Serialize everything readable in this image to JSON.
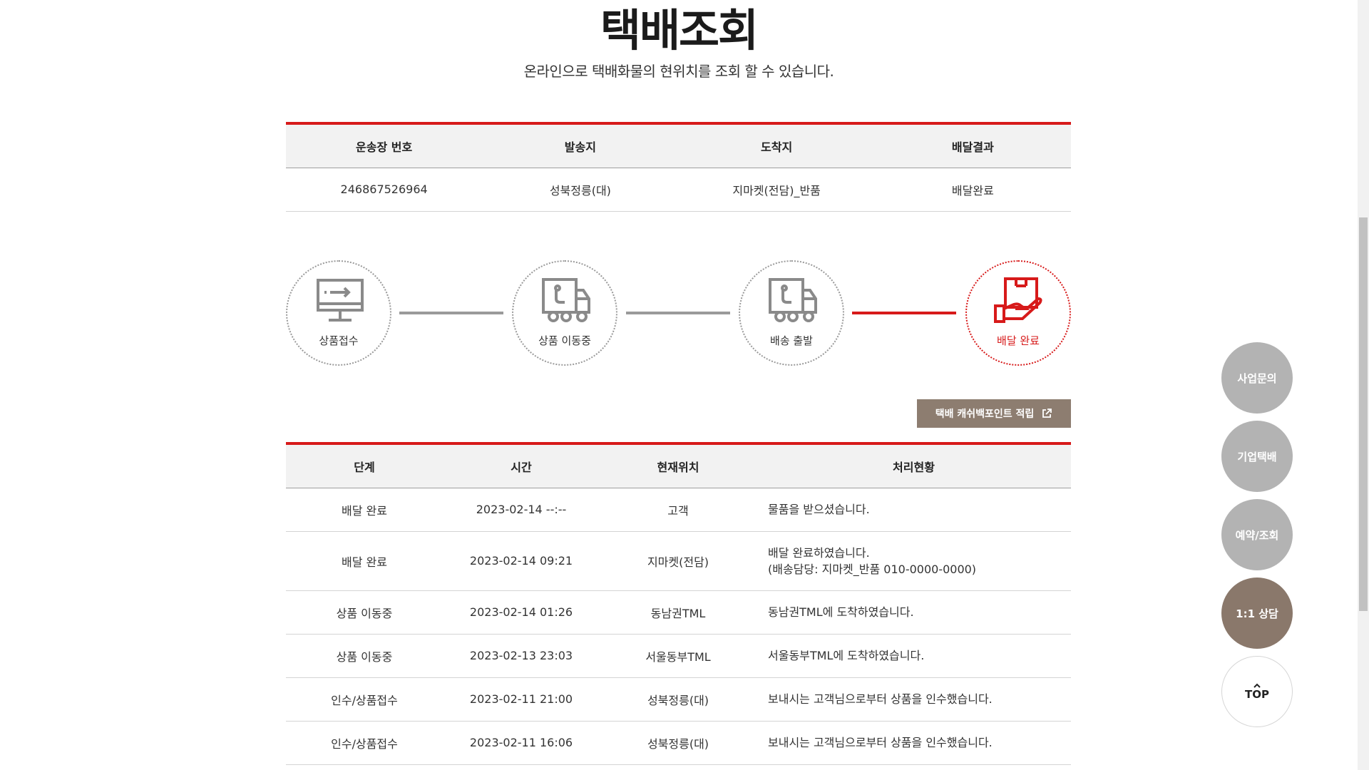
{
  "header": {
    "title": "택배조회",
    "subtitle": "온라인으로 택배화물의 현위치를 조회 할 수 있습니다."
  },
  "summary": {
    "headers": [
      "운송장 번호",
      "발송지",
      "도착지",
      "배달결과"
    ],
    "row": [
      "246867526964",
      "성북정릉(대)",
      "지마켓(전담)_반품",
      "배달완료"
    ]
  },
  "steps": [
    {
      "label": "상품접수",
      "icon": "monitor-icon"
    },
    {
      "label": "상품 이동중",
      "icon": "truck-icon"
    },
    {
      "label": "배송 출발",
      "icon": "truck-icon"
    },
    {
      "label": "배달 완료",
      "icon": "package-hand-icon"
    }
  ],
  "cashback_button": "택배 캐쉬백포인트 적립",
  "history": {
    "headers": [
      "단계",
      "시간",
      "현재위치",
      "처리현황"
    ],
    "rows": [
      {
        "stage": "배달 완료",
        "time": "2023-02-14 --:--",
        "location": "고객",
        "status": "물품을 받으셨습니다.",
        "status2": ""
      },
      {
        "stage": "배달 완료",
        "time": "2023-02-14 09:21",
        "location": "지마켓(전담)",
        "status": "배달 완료하였습니다.",
        "status2": "(배송담당: 지마켓_반품 010-0000-0000)"
      },
      {
        "stage": "상품 이동중",
        "time": "2023-02-14 01:26",
        "location": "동남권TML",
        "status": "동남권TML에 도착하였습니다.",
        "status2": ""
      },
      {
        "stage": "상품 이동중",
        "time": "2023-02-13 23:03",
        "location": "서울동부TML",
        "status": "서울동부TML에 도착하였습니다.",
        "status2": ""
      },
      {
        "stage": "인수/상품접수",
        "time": "2023-02-11 21:00",
        "location": "성북정릉(대)",
        "status": "보내시는 고객님으로부터 상품을 인수했습니다.",
        "status2": ""
      },
      {
        "stage": "인수/상품접수",
        "time": "2023-02-11 16:06",
        "location": "성북정릉(대)",
        "status": "보내시는 고객님으로부터 상품을 인수했습니다.",
        "status2": ""
      }
    ]
  },
  "side_buttons": {
    "business": "사업문의",
    "corporate": "기업택배",
    "reserve": "예약/조회",
    "consult": "1:1 상담",
    "top": "TOP"
  },
  "colors": {
    "accent": "#d71a1a",
    "brown": "#8a786b",
    "gray_button": "#b3b3b3"
  }
}
